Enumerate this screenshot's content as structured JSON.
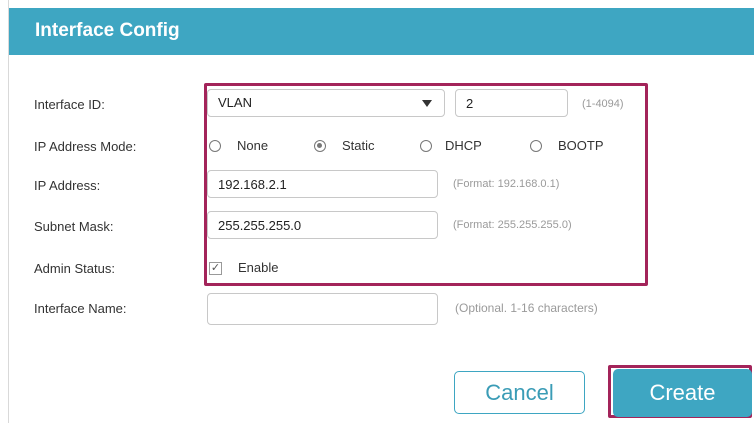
{
  "dialog": {
    "title": "Interface Config"
  },
  "form": {
    "interface_id": {
      "label": "Interface ID:",
      "type_value": "VLAN",
      "id_value": "2",
      "hint": "(1-4094)"
    },
    "ip_mode": {
      "label": "IP Address Mode:",
      "options": [
        "None",
        "Static",
        "DHCP",
        "BOOTP"
      ],
      "selected": "Static"
    },
    "ip_address": {
      "label": "IP Address:",
      "value": "192.168.2.1",
      "hint": "(Format: 192.168.0.1)"
    },
    "subnet_mask": {
      "label": "Subnet Mask:",
      "value": "255.255.255.0",
      "hint": "(Format: 255.255.255.0)"
    },
    "admin_status": {
      "label": "Admin Status:",
      "checkbox_label": "Enable",
      "checked": true
    },
    "interface_name": {
      "label": "Interface Name:",
      "value": "",
      "hint": "(Optional. 1-16 characters)"
    }
  },
  "buttons": {
    "cancel": "Cancel",
    "create": "Create"
  },
  "colors": {
    "header": "#3ea6c2",
    "highlight": "#a3245a"
  }
}
